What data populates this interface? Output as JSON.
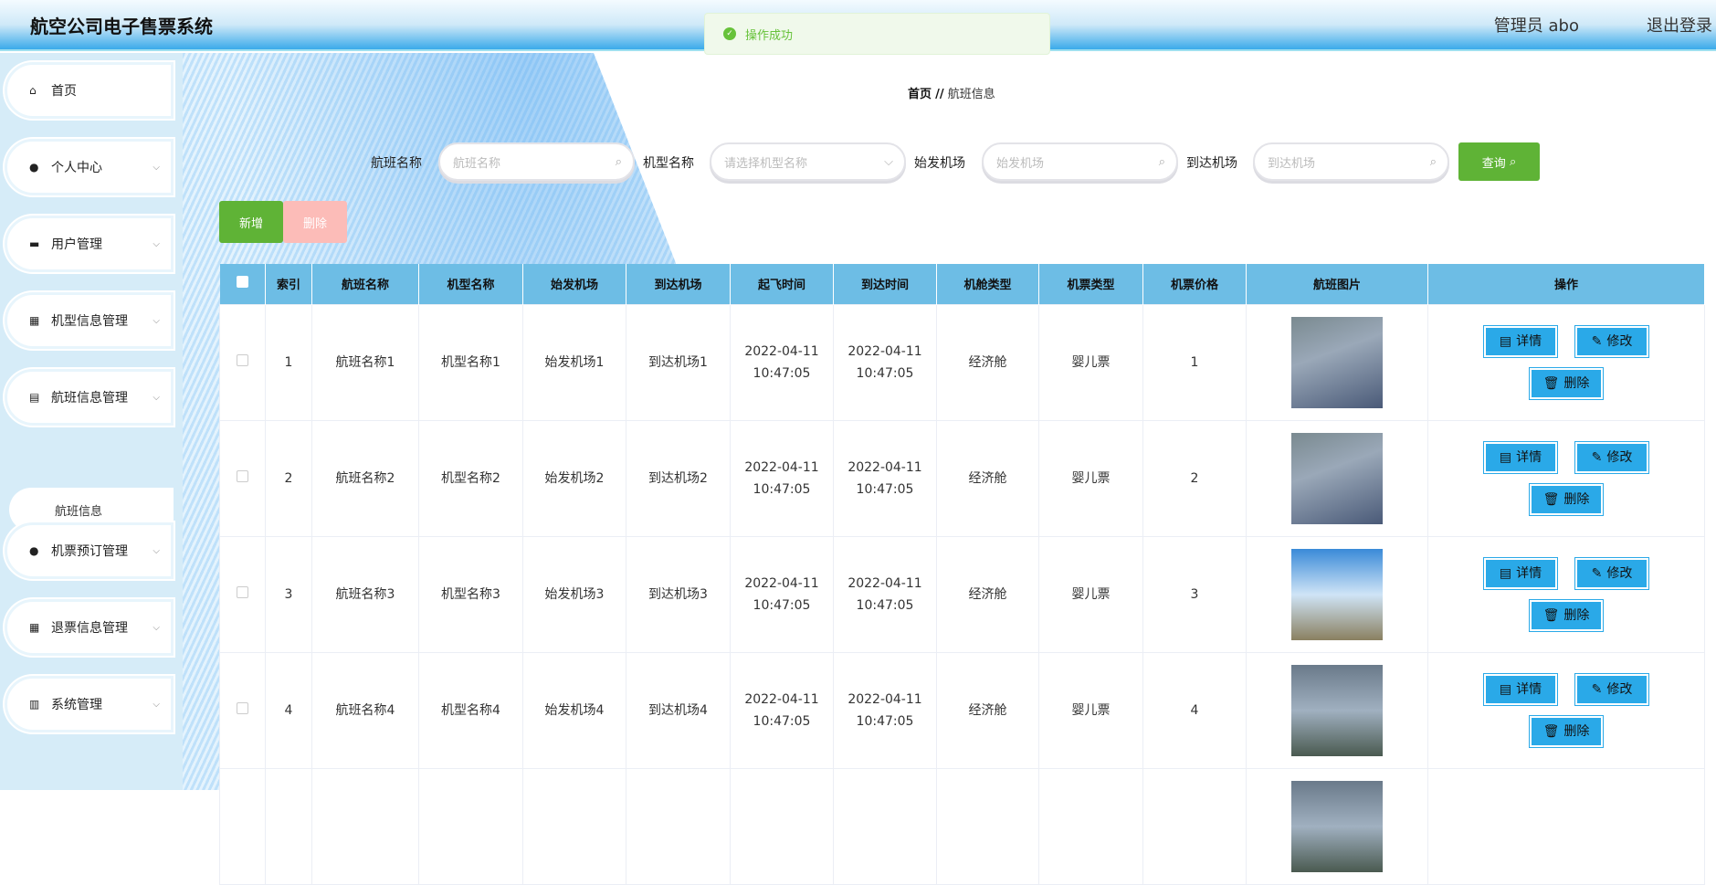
{
  "header": {
    "title": "航空公司电子售票系统",
    "user": "管理员 abo",
    "logout": "退出登录"
  },
  "toast": {
    "message": "操作成功"
  },
  "sidebar": {
    "items": [
      {
        "label": "首页",
        "icon": "home-icon"
      },
      {
        "label": "个人中心",
        "icon": "user-icon"
      },
      {
        "label": "用户管理",
        "icon": "briefcase-icon"
      },
      {
        "label": "机型信息管理",
        "icon": "grid-icon"
      },
      {
        "label": "航班信息管理",
        "icon": "clipboard-icon"
      },
      {
        "label": "机票预订管理",
        "icon": "user-icon"
      },
      {
        "label": "退票信息管理",
        "icon": "grid-icon"
      },
      {
        "label": "系统管理",
        "icon": "chart-icon"
      }
    ],
    "sub_item": "航班信息"
  },
  "breadcrumb": {
    "home": "首页",
    "sep": "//",
    "current": "航班信息"
  },
  "search": {
    "fields": [
      {
        "label": "航班名称",
        "placeholder": "航班名称"
      },
      {
        "label": "机型名称",
        "placeholder": "请选择机型名称"
      },
      {
        "label": "始发机场",
        "placeholder": "始发机场"
      },
      {
        "label": "到达机场",
        "placeholder": "到达机场"
      }
    ],
    "query": "查询"
  },
  "actions": {
    "add": "新增",
    "delete": "删除"
  },
  "table": {
    "headers": [
      "索引",
      "航班名称",
      "机型名称",
      "始发机场",
      "到达机场",
      "起飞时间",
      "到达时间",
      "机舱类型",
      "机票类型",
      "机票价格",
      "航班图片",
      "操作"
    ],
    "rows": [
      [
        "1",
        "航班名称1",
        "机型名称1",
        "始发机场1",
        "到达机场1",
        "2022-04-11 10:47:05",
        "2022-04-11 10:47:05",
        "经济舱",
        "婴儿票",
        "1"
      ],
      [
        "2",
        "航班名称2",
        "机型名称2",
        "始发机场2",
        "到达机场2",
        "2022-04-11 10:47:05",
        "2022-04-11 10:47:05",
        "经济舱",
        "婴儿票",
        "2"
      ],
      [
        "3",
        "航班名称3",
        "机型名称3",
        "始发机场3",
        "到达机场3",
        "2022-04-11 10:47:05",
        "2022-04-11 10:47:05",
        "经济舱",
        "婴儿票",
        "3"
      ],
      [
        "4",
        "航班名称4",
        "机型名称4",
        "始发机场4",
        "到达机场4",
        "2022-04-11 10:47:05",
        "2022-04-11 10:47:05",
        "经济舱",
        "婴儿票",
        "4"
      ]
    ],
    "row_actions": {
      "detail": "详情",
      "edit": "修改",
      "delete": "删除"
    }
  }
}
